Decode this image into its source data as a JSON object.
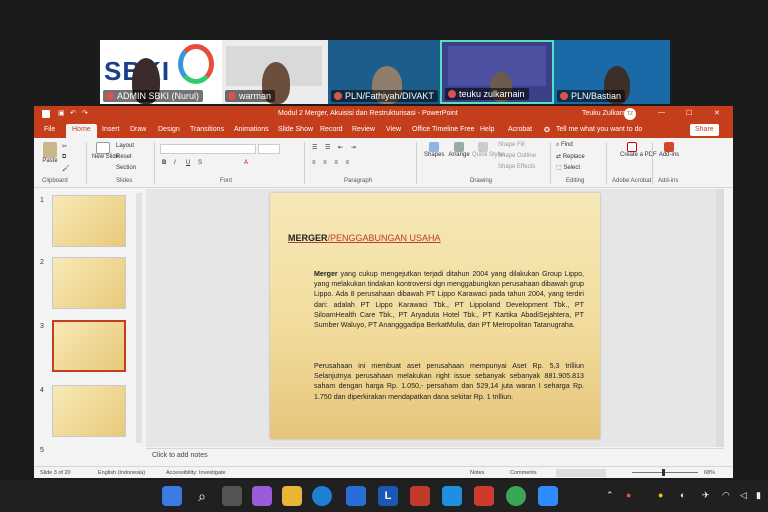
{
  "meeting": {
    "participants": [
      {
        "name": "ADMIN SBKI (Nurul)",
        "bg": "#ffffff"
      },
      {
        "name": "warman",
        "bg": "#e9e9e9"
      },
      {
        "name": "PLN/Fathiyah/DIVAKT",
        "bg": "#1c5d8c"
      },
      {
        "name": "teuku zulkarnain",
        "bg": "#3a3f8a"
      },
      {
        "name": "PLN/Bastian",
        "bg": "#1a6aa8"
      }
    ],
    "banner_text": "SBKI"
  },
  "window": {
    "title": "Modul 2 Merger, Akuisisi dan Restrukturisasi - PowerPoint",
    "user": "Teuku Zulkarnain",
    "user_initials": "TZ",
    "share_label": "Share"
  },
  "tabs": [
    "File",
    "Home",
    "Insert",
    "Draw",
    "Design",
    "Transitions",
    "Animations",
    "Slide Show",
    "Record",
    "Review",
    "View",
    "Office Timeline Free",
    "Help",
    "Acrobat"
  ],
  "search": {
    "placeholder": "Tell me what you want to do"
  },
  "ribbon": {
    "groups": [
      "Clipboard",
      "Slides",
      "Font",
      "Paragraph",
      "Drawing",
      "Editing",
      "Adobe Acrobat",
      "Add-ins"
    ],
    "paste": "Paste",
    "new_slide": "New Slide",
    "layout": "Layout",
    "reset": "Reset",
    "section": "Section",
    "shapes": "Shapes",
    "arrange": "Arrange",
    "quick_styles": "Quick Styles",
    "shape_fill": "Shape Fill",
    "shape_outline": "Shape Outline",
    "shape_effects": "Shape Effects",
    "find": "Find",
    "replace": "Replace",
    "select": "Select",
    "create_pdf": "Create a PDF",
    "add_ins": "Add-ins"
  },
  "thumbnails": [
    "1",
    "2",
    "3",
    "4",
    "5"
  ],
  "slide": {
    "title_bold": "MERGER",
    "title_rest": "/PENGGABUNGAN USAHA",
    "para1_bold": "Merger",
    "para1": " yang cukup mengejutkan terjadi ditahun 2004 yang dilakukan Group Lippo, yang melakukan tindakan kontroversi dgn menggabungkan perusahaan dibawah grup Lippo. Ada 8 perusahaan dibawah PT Lippo Karawaci pada tahun 2004, yang terdiri dari: adalah PT Lippo Karawaci Tbk., PT Lippoland Development Tbk., PT SiloamHealth Care Tbk., PT Aryaduta Hotel Tbk., PT Kartika AbadiSejahtera, PT Sumber Waluyo, PT Anangggadipa BerkatMulia, dan PT Metropolitan Tatanugraha.",
    "para2": "Perusahaan ini membuat aset perusahaan mempunyai Aset Rp. 5,3 trilliun Selanjutnya perusahaan melakukan right issue sebanyak sebanyak 881.905.813 saham dengan harga Rp. 1.050,- persaham dan 529,14 juta waran I seharga Rp. 1.750 dan diperkirakan mendapatkan dana sekitar Rp. 1 trilliun."
  },
  "notes_placeholder": "Click to add notes",
  "status": {
    "slide_of": "Slide 3 of 20",
    "language": "English (Indonesia)",
    "accessibility": "Accessibility: Investigate",
    "notes": "Notes",
    "comments": "Comments",
    "zoom": "68%"
  },
  "colors": {
    "accent": "#c43e1c",
    "title_red": "#c0392b"
  }
}
